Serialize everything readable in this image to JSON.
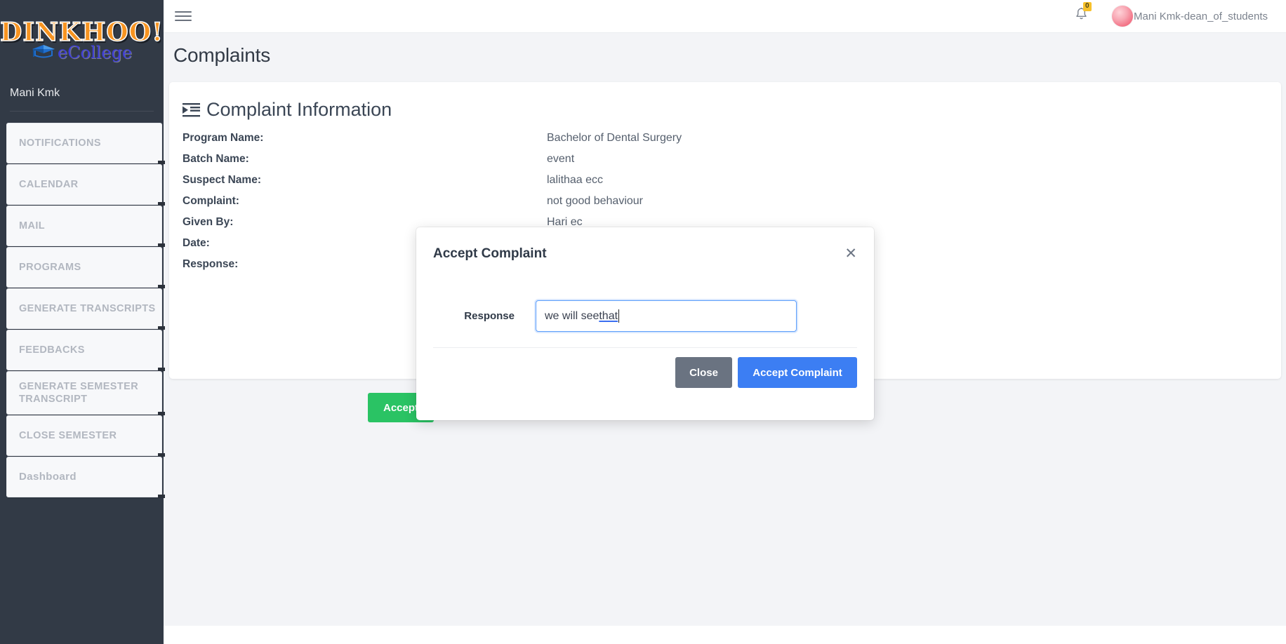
{
  "brand": {
    "logo_main": "DINKHOO!",
    "logo_sub": "eCollege",
    "cap_icon": "graduation-cap-icon",
    "user_name": "Mani Kmk"
  },
  "sidebar": {
    "items": [
      {
        "label": "NOTIFICATIONS"
      },
      {
        "label": "CALENDAR"
      },
      {
        "label": "MAIL"
      },
      {
        "label": "PROGRAMS"
      },
      {
        "label": "GENERATE TRANSCRIPTS"
      },
      {
        "label": "FEEDBACKS"
      },
      {
        "label": "GENERATE SEMESTER TRANSCRIPT"
      },
      {
        "label": "CLOSE SEMESTER"
      },
      {
        "label": "Dashboard"
      }
    ]
  },
  "topbar": {
    "menu_icon": "hamburger-icon",
    "bell_icon": "bell-icon",
    "notification_count": "0",
    "avatar_icon": "user-avatar",
    "user_display": "Mani Kmk-dean_of_students"
  },
  "page": {
    "title": "Complaints"
  },
  "card": {
    "icon": "indent-list-icon",
    "title": "Complaint Information",
    "rows": [
      {
        "label": "Program Name:",
        "value": "Bachelor of Dental Surgery"
      },
      {
        "label": "Batch Name:",
        "value": "event"
      },
      {
        "label": "Suspect Name:",
        "value": "lalithaa ecc"
      },
      {
        "label": "Complaint:",
        "value": "not good behaviour"
      },
      {
        "label": "Given By:",
        "value": "Hari ec"
      },
      {
        "label": "Date:",
        "value": ""
      },
      {
        "label": "Response:",
        "value": ""
      }
    ],
    "accept_label": "Accept"
  },
  "modal": {
    "title": "Accept Complaint",
    "close_icon": "close-icon",
    "response_label": "Response",
    "response_value_plain": "we will see ",
    "response_value_underlined": "that",
    "response_placeholder": "",
    "close_label": "Close",
    "submit_label": "Accept Complaint"
  },
  "colors": {
    "sidebar_bg": "#323a46",
    "accept_green": "#2ac364",
    "primary_blue": "#3c7ef3",
    "close_gray": "#6a7381",
    "badge_yellow": "#f7c12b",
    "logo_orange": "#f79421",
    "logo_blue": "#3f3fd8"
  }
}
